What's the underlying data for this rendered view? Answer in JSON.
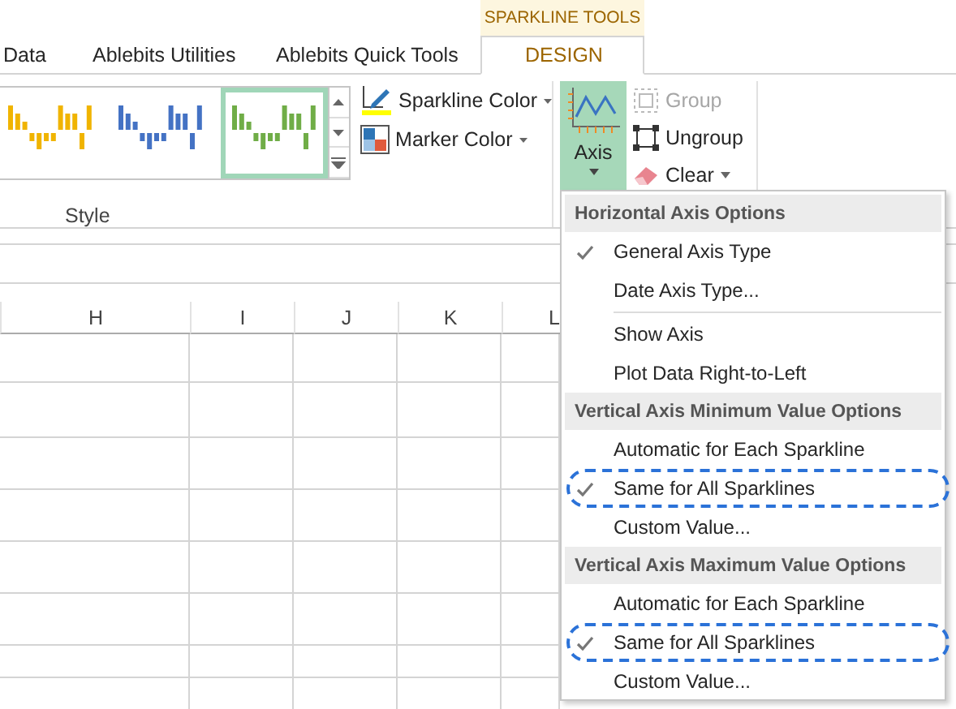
{
  "context_tab": {
    "label": "SPARKLINE TOOLS"
  },
  "tabs": [
    {
      "label": "Data",
      "selected": false
    },
    {
      "label": "Ablebits Utilities",
      "selected": false
    },
    {
      "label": "Ablebits Quick Tools",
      "selected": false
    },
    {
      "label": "DESIGN",
      "selected": true
    }
  ],
  "style_gallery": {
    "label": "Style",
    "styles": [
      {
        "color": "#f0b400",
        "selected": false
      },
      {
        "color": "#4472c4",
        "selected": false
      },
      {
        "color": "#70ad47",
        "selected": true
      }
    ]
  },
  "color_buttons": [
    "Sparkline Color",
    "Marker Color"
  ],
  "axis_button": {
    "label": "Axis",
    "expanded": true
  },
  "group_buttons": [
    {
      "label": "Group",
      "disabled": true,
      "kind": "group"
    },
    {
      "label": "Ungroup",
      "disabled": false,
      "kind": "ungroup"
    },
    {
      "label": "Clear",
      "disabled": false,
      "kind": "clear"
    }
  ],
  "sheet": {
    "columns": [
      "H",
      "I",
      "J",
      "K",
      "L"
    ]
  },
  "axis_menu": [
    {
      "kind": "header",
      "label": "Horizontal Axis Options"
    },
    {
      "kind": "item",
      "label": "General Axis Type",
      "checked": true,
      "highlighted": false
    },
    {
      "kind": "item",
      "label": "Date Axis Type...",
      "checked": false,
      "highlighted": false
    },
    {
      "kind": "separator"
    },
    {
      "kind": "item",
      "label": "Show Axis",
      "checked": false,
      "highlighted": false
    },
    {
      "kind": "item",
      "label": "Plot Data Right-to-Left",
      "checked": false,
      "highlighted": false
    },
    {
      "kind": "header",
      "label": "Vertical Axis Minimum Value Options"
    },
    {
      "kind": "item",
      "label": "Automatic for Each Sparkline",
      "checked": false,
      "highlighted": false
    },
    {
      "kind": "item",
      "label": "Same for All Sparklines",
      "checked": true,
      "highlighted": true
    },
    {
      "kind": "item",
      "label": "Custom Value...",
      "checked": false,
      "highlighted": false
    },
    {
      "kind": "header",
      "label": "Vertical Axis Maximum Value Options"
    },
    {
      "kind": "item",
      "label": "Automatic for Each Sparkline",
      "checked": false,
      "highlighted": false
    },
    {
      "kind": "item",
      "label": "Same for All Sparklines",
      "checked": true,
      "highlighted": true
    },
    {
      "kind": "item",
      "label": "Custom Value...",
      "checked": false,
      "highlighted": false
    }
  ]
}
